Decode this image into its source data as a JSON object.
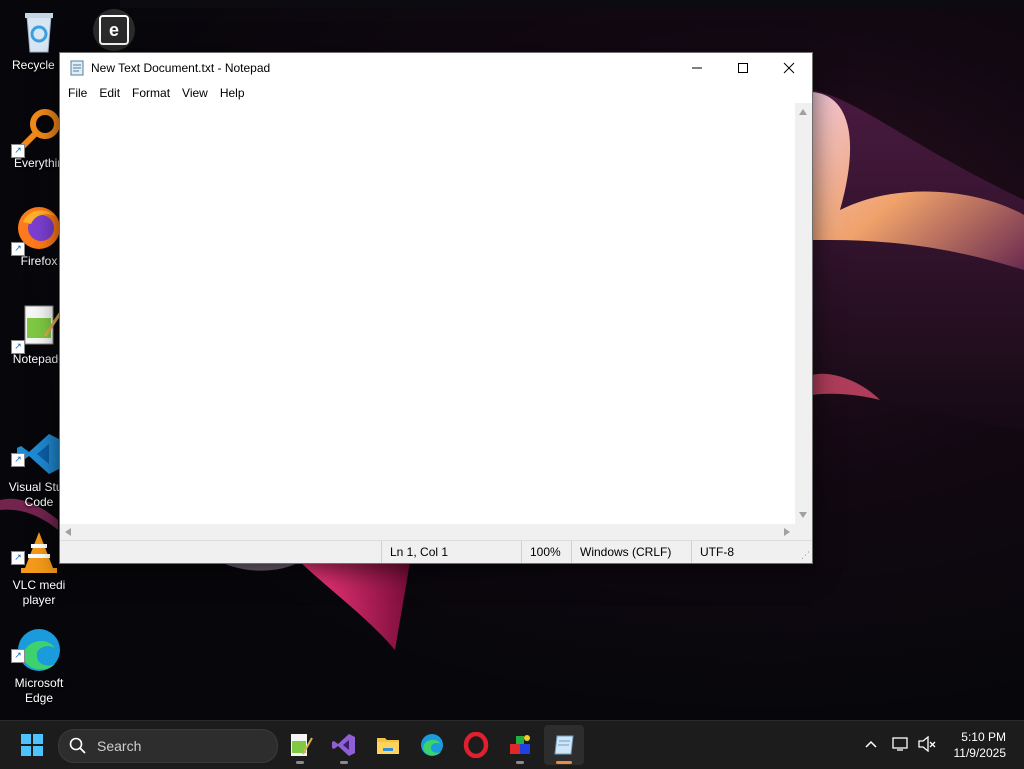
{
  "desktop": {
    "icons": [
      {
        "label": "Recycle B",
        "icon": "recycle-bin-icon"
      },
      {
        "label": "Everythin",
        "icon": "everything-search-icon"
      },
      {
        "label": "Firefox",
        "icon": "firefox-icon"
      },
      {
        "label": "Notepad+",
        "icon": "notepad-plus-plus-icon"
      },
      {
        "label": "Visual Stud\nCode",
        "icon": "vscode-icon"
      },
      {
        "label": "VLC medi\nplayer",
        "icon": "vlc-icon"
      },
      {
        "label": "Microsoft\nEdge",
        "icon": "edge-icon"
      }
    ]
  },
  "notepad": {
    "title": "New Text Document.txt - Notepad",
    "menus": [
      "File",
      "Edit",
      "Format",
      "View",
      "Help"
    ],
    "content": "",
    "status": {
      "position": "Ln 1, Col 1",
      "zoom": "100%",
      "line_ending": "Windows (CRLF)",
      "encoding": "UTF-8"
    }
  },
  "taskbar": {
    "search_label": "Search",
    "apps": [
      "notepad-plus-plus-icon",
      "visual-studio-icon",
      "file-explorer-icon",
      "edge-icon",
      "opera-icon",
      "paint-tool-icon",
      "notepad-icon"
    ],
    "clock": {
      "time": "5:10 PM",
      "date": "11/9/2025"
    }
  },
  "colors": {
    "accent": "#e98a47",
    "taskbar": "#1c1c1c",
    "window": "#ffffff"
  }
}
